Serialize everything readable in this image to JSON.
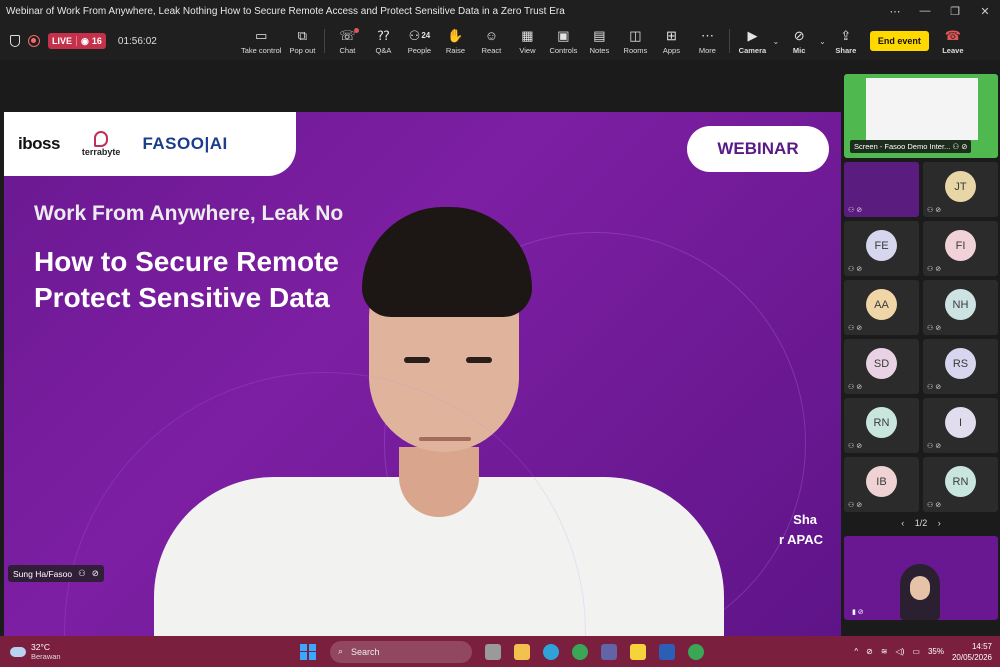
{
  "window": {
    "title": "Webinar of Work From Anywhere, Leak Nothing How to Secure Remote Access and Protect Sensitive Data in a Zero Trust Era",
    "controls": [
      "⋯",
      "—",
      "❐",
      "✕"
    ]
  },
  "status": {
    "live": "LIVE",
    "viewers": "16",
    "elapsed": "01:56:02"
  },
  "toolbar": {
    "take_control": "Take control",
    "pop_out": "Pop out",
    "chat": "Chat",
    "qa": "Q&A",
    "people": "People",
    "people_count": "24",
    "raise": "Raise",
    "react": "React",
    "view": "View",
    "controls": "Controls",
    "notes": "Notes",
    "rooms": "Rooms",
    "apps": "Apps",
    "more": "More",
    "camera": "Camera",
    "mic": "Mic",
    "share": "Share",
    "end_event": "End event",
    "leave": "Leave"
  },
  "slide": {
    "logo_iboss": "iboss",
    "logo_terrabyte": "terrabyte",
    "logo_fasoo": "FASOO|AI",
    "badge": "WEBINAR",
    "subtitle": "Work From Anywhere, Leak No",
    "title_line1": "How to Secure Remote",
    "title_line2": "Protect Sensitive Data          st Era",
    "speaker_name_fragment": "Sha",
    "speaker_role_fragment": "r APAC"
  },
  "stage": {
    "presenter_label": "Sung Ha/Fasoo"
  },
  "panel": {
    "screen_share_label": "Screen - Fasoo Demo Inter...",
    "participants": [
      {
        "initials": "",
        "color": "#5a1c7e",
        "video": true
      },
      {
        "initials": "JT",
        "color": "#e8d6a6"
      },
      {
        "initials": "FE",
        "color": "#d6d6ee"
      },
      {
        "initials": "FI",
        "color": "#f1d2d8"
      },
      {
        "initials": "AA",
        "color": "#f0d6a6"
      },
      {
        "initials": "NH",
        "color": "#cde3e3"
      },
      {
        "initials": "SD",
        "color": "#e9d2e4"
      },
      {
        "initials": "RS",
        "color": "#d8d6ee"
      },
      {
        "initials": "RN",
        "color": "#c9e6de"
      },
      {
        "initials": "I",
        "color": "#e2dcef"
      },
      {
        "initials": "IB",
        "color": "#eed2d4"
      },
      {
        "initials": "RN",
        "color": "#c9e6de"
      }
    ],
    "page": "1/2"
  },
  "taskbar": {
    "temperature": "32°C",
    "condition": "Berawan",
    "search_placeholder": "Search",
    "battery": "35%",
    "time": "14:57",
    "date": "20/05/2026"
  }
}
